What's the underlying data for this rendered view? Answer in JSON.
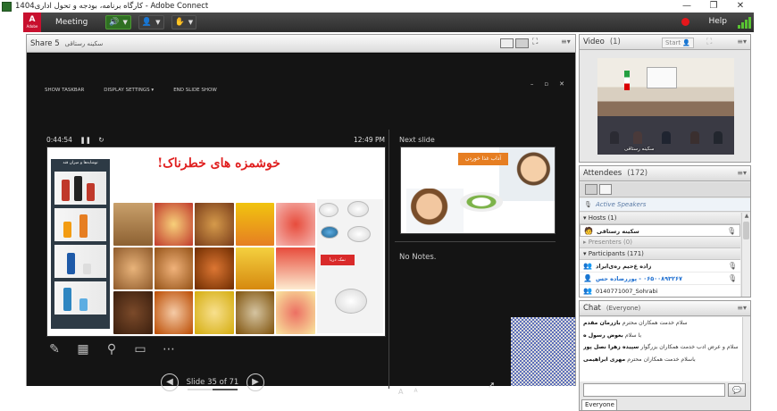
{
  "window": {
    "title": "کارگاه برنامه، بودجه و تحول اداری1404 - Adobe Connect",
    "minimize": "—",
    "maximize": "❐",
    "close": "✕"
  },
  "appbar": {
    "logo_letter": "A",
    "logo_text": "Adobe",
    "meeting_menu": "Meeting",
    "help": "Help"
  },
  "share": {
    "pod_title": "Share 5",
    "presenter_name": "سکینه رستاقی",
    "ppt_toolbar": [
      "SHOW TASKBAR",
      "DISPLAY SETTINGS ▾",
      "END SLIDE SHOW"
    ],
    "timer": "0:44:54",
    "clock": "12:49 PM",
    "next_slide_label": "Next slide",
    "notes_label": "No Notes.",
    "slide_counter": "Slide 35 of 71",
    "slide_current": 35,
    "slide_total": 71,
    "slide": {
      "title": "خوشمزه های خطرناک!",
      "left_caption": "نوشابه‌ها و میزان قند",
      "salt_label": "نمک دریا"
    },
    "next_slide": {
      "banner": "آداب غذا خوردن"
    },
    "font_buttons": [
      "A",
      "A"
    ]
  },
  "video": {
    "pod_title": "Video",
    "count": "(1)",
    "start_button": "Start",
    "feed_name": "سکینه رستاقی"
  },
  "attendees": {
    "pod_title": "Attendees",
    "count": "(172)",
    "active_speakers": "Active Speakers",
    "groups": [
      {
        "label": "▾ Hosts (1)"
      },
      {
        "label": "▸ Presenters (0)"
      },
      {
        "label": "▾ Participants (171)"
      }
    ],
    "host": "سکینه رستاقی",
    "participants": [
      "زاده ع‌حیم ره‌ی‌ابراد",
      "۰۶۵۰۰۸۹۳۲۶۷ - پوررضا‌ده حس",
      "0140771007_Sohrabi"
    ]
  },
  "chat": {
    "pod_title": "Chat",
    "scope": "(Everyone)",
    "messages": [
      {
        "text": "سلام خدمت همکاران محترم ",
        "sender": "بازرمان مقدم"
      },
      {
        "text": "با سلام ",
        "sender": "بعوض رسول ه"
      },
      {
        "text": "سلام و عرض ادب خدمت همکاران بزرگوار ",
        "sender": "سپیده زهرا نصل پور"
      },
      {
        "text": "باسلام خدمت همکاران محترم ",
        "sender": "مهری ابراهیمی"
      }
    ],
    "send_icon": "speech-bubble-icon",
    "tab_label": "Everyone"
  }
}
